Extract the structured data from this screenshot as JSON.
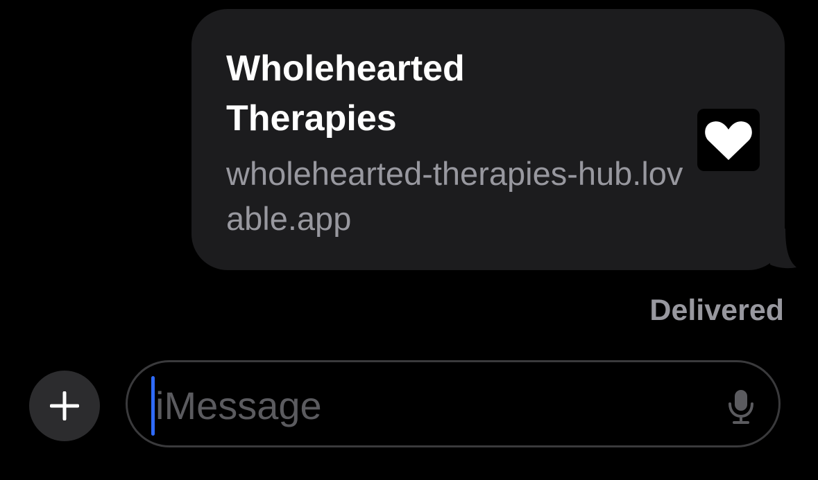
{
  "message": {
    "link_preview": {
      "title": "Wholehearted Therapies",
      "url": "wholehearted-therapies-hub.lovable.app",
      "thumbnail_icon": "heart-icon"
    },
    "status": "Delivered"
  },
  "composer": {
    "placeholder": "iMessage",
    "add_button_icon": "plus-icon",
    "mic_icon": "microphone-icon"
  },
  "colors": {
    "background": "#000000",
    "bubble": "#1c1c1e",
    "secondary_text": "#98989f",
    "caret": "#2f6bff"
  }
}
